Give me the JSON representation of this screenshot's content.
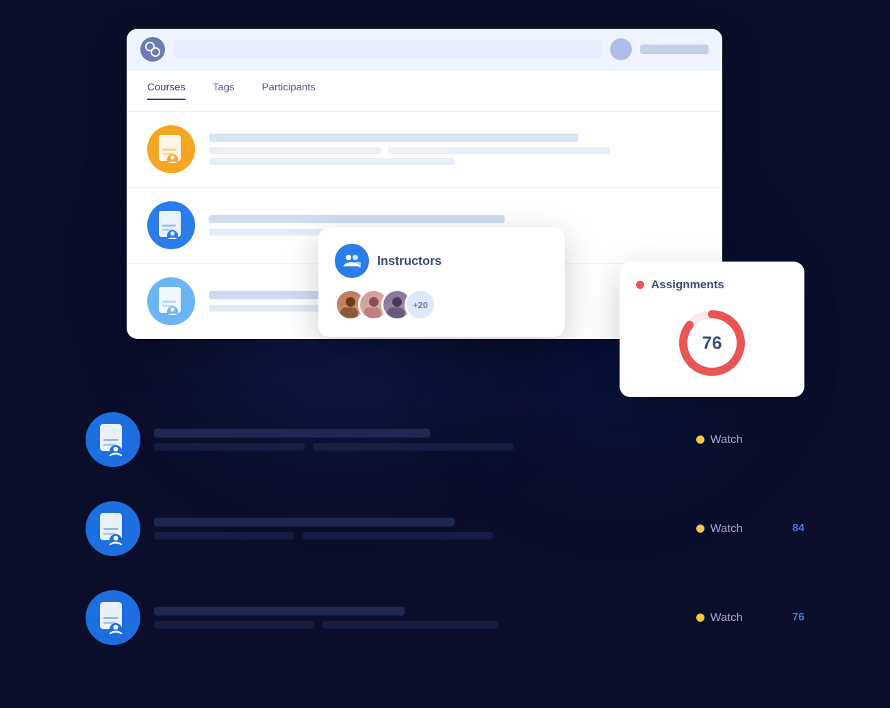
{
  "app": {
    "logo_alt": "App logo"
  },
  "nav": {
    "items": [
      {
        "label": "Courses",
        "active": true
      },
      {
        "label": "Tags",
        "active": false
      },
      {
        "label": "Participants",
        "active": false
      }
    ]
  },
  "instructors_card": {
    "title": "Instructors",
    "plus_count": "+20"
  },
  "assignments_card": {
    "title": "Assignments",
    "value": "76"
  },
  "rows": [
    {
      "watch_label": "Watch",
      "number": ""
    },
    {
      "watch_label": "Watch",
      "number": "84"
    },
    {
      "watch_label": "Watch",
      "number": "76"
    }
  ],
  "donut": {
    "value": 76,
    "max": 100,
    "color": "#e85555",
    "track_color": "#fce8e8"
  }
}
